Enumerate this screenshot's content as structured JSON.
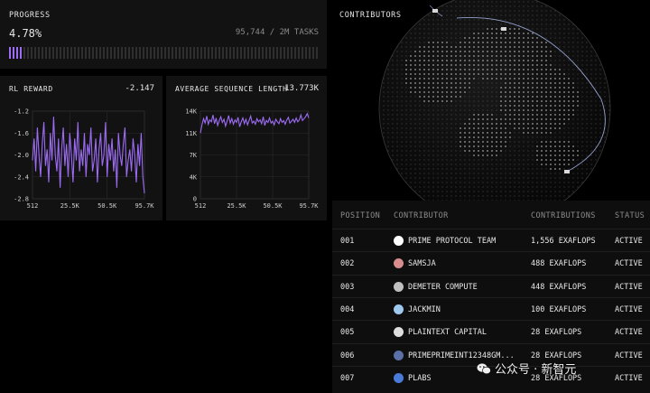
{
  "progress": {
    "title": "PROGRESS",
    "percent_text": "4.78%",
    "tasks_text": "95,744 / 2M TASKS",
    "fraction": 0.0478,
    "accent": "#9d6cf5"
  },
  "reward_chart": {
    "title": "RL REWARD",
    "current_value": "-2.147"
  },
  "seq_chart": {
    "title": "AVERAGE SEQUENCE LENGTH",
    "current_value": "13.773K"
  },
  "chart_data": [
    {
      "type": "line",
      "title": "RL REWARD",
      "x_tick_labels": [
        "512",
        "25.5K",
        "50.5K",
        "95.7K"
      ],
      "y_tick_labels": [
        "-1.2",
        "-1.6",
        "-2.0",
        "-2.4",
        "-2.8"
      ],
      "ylim": [
        -2.8,
        -1.2
      ],
      "grid": true,
      "color": "#9d6cf5",
      "values": [
        -2.1,
        -1.7,
        -2.3,
        -1.5,
        -2.0,
        -2.4,
        -1.8,
        -1.4,
        -2.2,
        -1.9,
        -2.5,
        -1.6,
        -2.1,
        -1.3,
        -2.0,
        -2.3,
        -1.7,
        -2.6,
        -1.9,
        -1.5,
        -2.2,
        -1.8,
        -2.4,
        -1.6,
        -2.0,
        -2.5,
        -1.7,
        -2.1,
        -1.4,
        -2.3,
        -1.9,
        -2.2,
        -1.6,
        -2.4,
        -1.8,
        -2.0,
        -1.5,
        -2.3,
        -2.1,
        -1.7,
        -2.5,
        -1.9,
        -1.6,
        -2.2,
        -2.0,
        -1.4,
        -2.4,
        -1.8,
        -2.1,
        -1.7,
        -2.3,
        -1.9,
        -2.6,
        -1.6,
        -2.0,
        -2.2,
        -1.8,
        -1.5,
        -2.4,
        -2.1,
        -1.9,
        -2.3,
        -1.7,
        -2.0,
        -2.5,
        -1.8,
        -2.2,
        -1.6,
        -2.4,
        -2.7
      ]
    },
    {
      "type": "line",
      "title": "AVERAGE SEQUENCE LENGTH",
      "x_tick_labels": [
        "512",
        "25.5K",
        "50.5K",
        "95.7K"
      ],
      "y_tick_labels": [
        "14K",
        "11K",
        "7K",
        "4K",
        "0"
      ],
      "ylim": [
        0,
        14000
      ],
      "grid": true,
      "color": "#9d6cf5",
      "values": [
        10500,
        11800,
        12800,
        12100,
        13200,
        11900,
        12600,
        12300,
        13400,
        12000,
        12900,
        11700,
        12500,
        13100,
        12200,
        12700,
        11600,
        12400,
        13300,
        12100,
        12800,
        11900,
        12600,
        12200,
        13000,
        11500,
        12300,
        12900,
        12000,
        12700,
        11800,
        12500,
        13200,
        12100,
        12400,
        11900,
        12800,
        12300,
        12600,
        12000,
        13100,
        11700,
        12500,
        12200,
        12900,
        12100,
        12400,
        11800,
        12700,
        12300,
        12000,
        12800,
        12200,
        12500,
        11900,
        12600,
        13000,
        12100,
        12400,
        12700,
        12200,
        12900,
        12300,
        12600,
        13400,
        12500,
        12800,
        13100,
        13600,
        12900
      ]
    }
  ],
  "globe": {
    "title": "CONTRIBUTORS"
  },
  "table": {
    "headers": {
      "position": "POSITION",
      "contributor": "CONTRIBUTOR",
      "contributions": "CONTRIBUTIONS",
      "status": "STATUS"
    },
    "rows": [
      {
        "position": "001",
        "contributor": "PRIME PROTOCOL TEAM",
        "contributions": "1,556 EXAFLOPS",
        "status": "ACTIVE",
        "avatar_icon": "prime-logo-icon",
        "avatar_color": "#ffffff"
      },
      {
        "position": "002",
        "contributor": "SAMSJA",
        "contributions": "488 EXAFLOPS",
        "status": "ACTIVE",
        "avatar_icon": "user-avatar-icon",
        "avatar_color": "#d98c8c"
      },
      {
        "position": "003",
        "contributor": "DEMETER COMPUTE",
        "contributions": "448 EXAFLOPS",
        "status": "ACTIVE",
        "avatar_icon": "statue-avatar-icon",
        "avatar_color": "#bfbfbf"
      },
      {
        "position": "004",
        "contributor": "JACKMIN",
        "contributions": "100 EXAFLOPS",
        "status": "ACTIVE",
        "avatar_icon": "user-avatar-icon",
        "avatar_color": "#9ec8ee"
      },
      {
        "position": "005",
        "contributor": "PLAINTEXT CAPITAL",
        "contributions": "28 EXAFLOPS",
        "status": "ACTIVE",
        "avatar_icon": "ring-avatar-icon",
        "avatar_color": "#dddddd"
      },
      {
        "position": "006",
        "contributor": "PRIMEPRIMEINT12348GM...",
        "contributions": "28 EXAFLOPS",
        "status": "ACTIVE",
        "avatar_icon": "user-avatar-icon",
        "avatar_color": "#5b6fa8"
      },
      {
        "position": "007",
        "contributor": "PLABS",
        "contributions": "28 EXAFLOPS",
        "status": "ACTIVE",
        "avatar_icon": "plabs-logo-icon",
        "avatar_color": "#4a7bd8"
      }
    ]
  },
  "watermark": {
    "text": "公众号 · 新智元"
  }
}
